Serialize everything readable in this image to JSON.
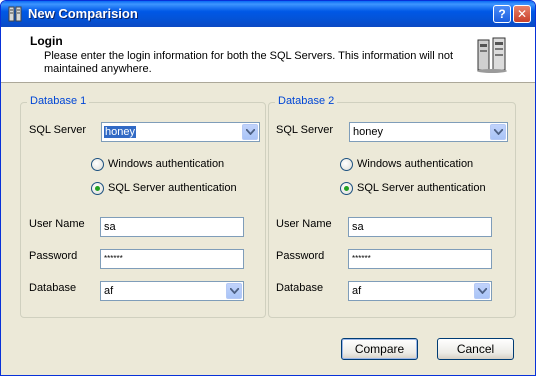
{
  "window": {
    "title": "New Comparision",
    "help_glyph": "?",
    "close_glyph": "✕"
  },
  "header": {
    "title": "Login",
    "description": "Please enter the login information for both the SQL Servers.  This information will not maintained anywhere."
  },
  "db1": {
    "legend": "Database 1",
    "server_label": "SQL Server",
    "server_value": "honey",
    "auth_windows": "Windows authentication",
    "auth_sql": "SQL Server authentication",
    "selected_auth": "sql",
    "username_label": "User Name",
    "username_value": "sa",
    "password_label": "Password",
    "password_mask": "******",
    "database_label": "Database",
    "database_value": "af"
  },
  "db2": {
    "legend": "Database 2",
    "server_label": "SQL Server",
    "server_value": "honey",
    "auth_windows": "Windows authentication",
    "auth_sql": "SQL Server authentication",
    "selected_auth": "sql",
    "username_label": "User Name",
    "username_value": "sa",
    "password_label": "Password",
    "password_mask": "******",
    "database_label": "Database",
    "database_value": "af"
  },
  "buttons": {
    "compare": "Compare",
    "cancel": "Cancel"
  }
}
